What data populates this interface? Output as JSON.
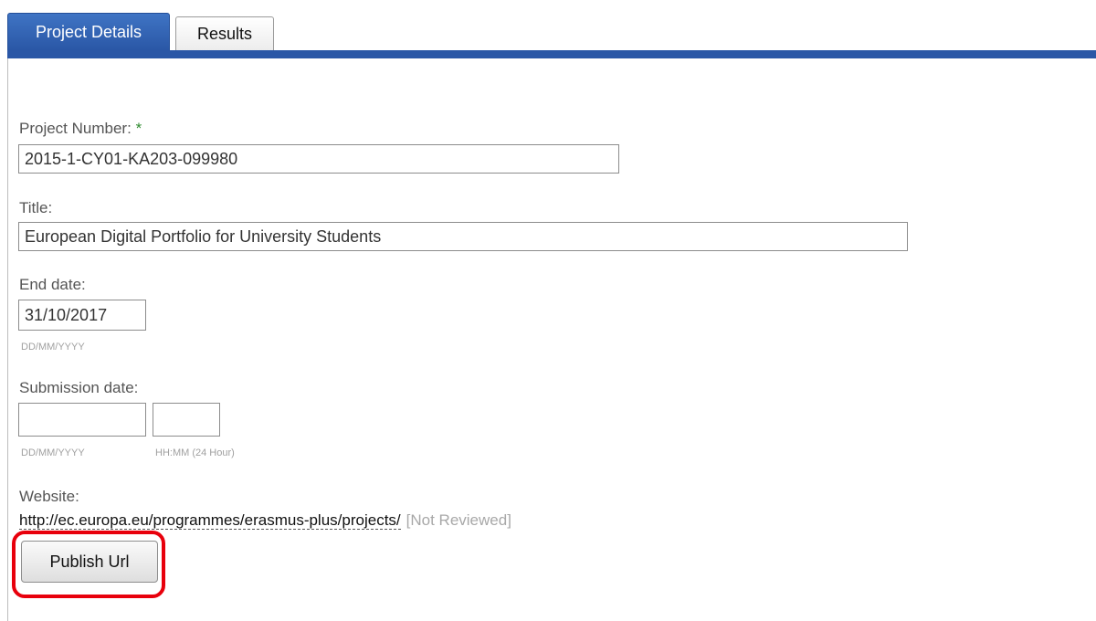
{
  "tabs": [
    {
      "label": "Project Details",
      "active": true
    },
    {
      "label": "Results",
      "active": false
    }
  ],
  "form": {
    "project_number": {
      "label": "Project Number:",
      "required_mark": "*",
      "value": "2015-1-CY01-KA203-099980"
    },
    "title": {
      "label": "Title:",
      "value": "European Digital Portfolio for University Students"
    },
    "end_date": {
      "label": "End date:",
      "value": "31/10/2017",
      "hint": "DD/MM/YYYY"
    },
    "submission_date": {
      "label": "Submission date:",
      "date_value": "",
      "time_value": "",
      "date_hint": "DD/MM/YYYY",
      "time_hint": "HH:MM (24 Hour)"
    },
    "website": {
      "label": "Website:",
      "url": "http://ec.europa.eu/programmes/erasmus-plus/projects/",
      "status": "[Not Reviewed]"
    },
    "publish_button": "Publish Url"
  },
  "colors": {
    "tab_active": "#2a57a6",
    "required": "#2e8b2e",
    "highlight": "#e8000c"
  }
}
